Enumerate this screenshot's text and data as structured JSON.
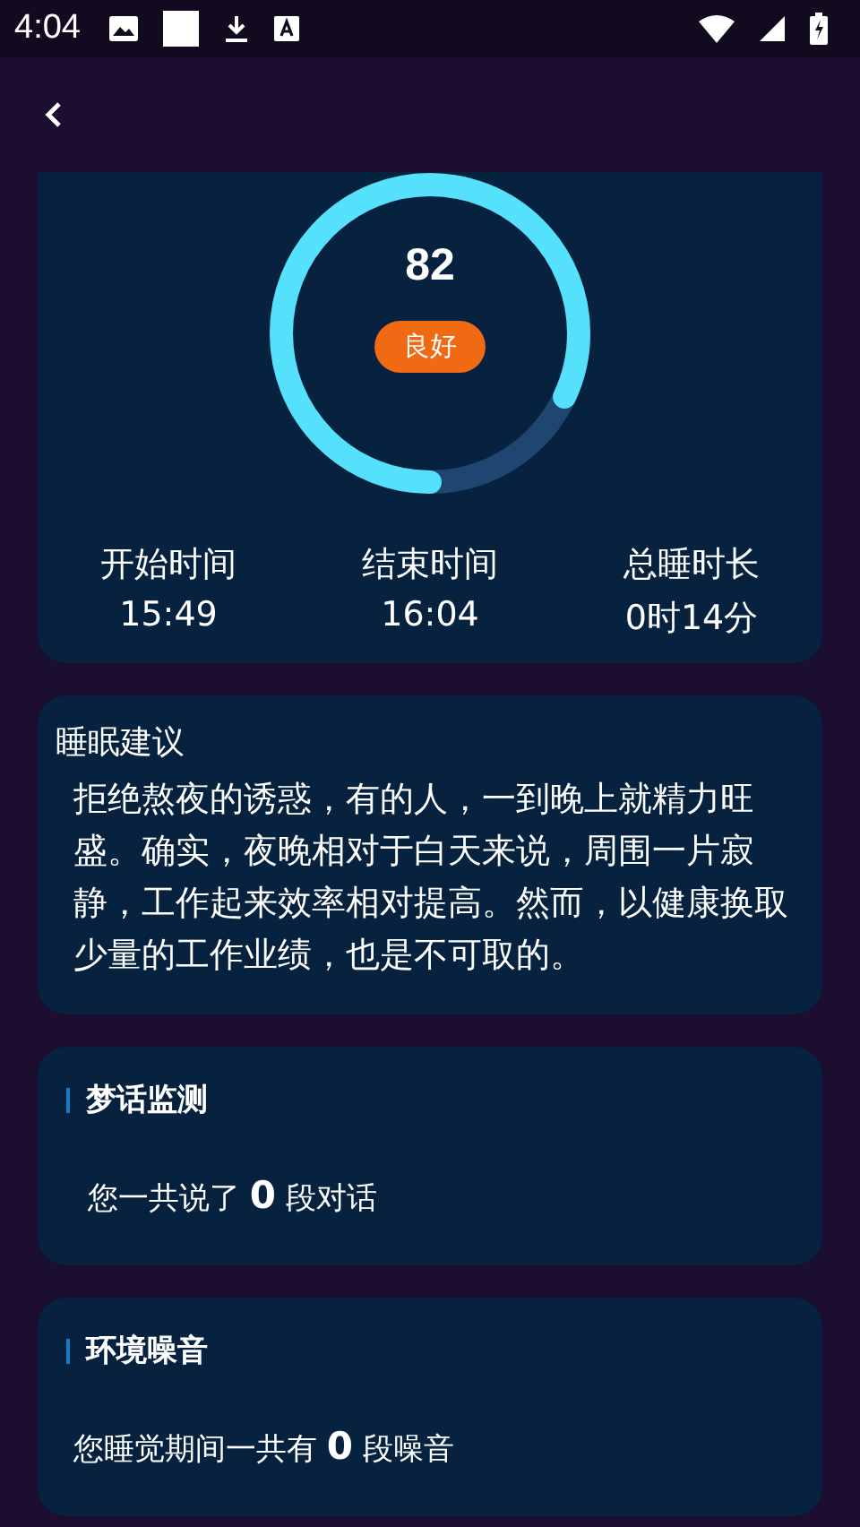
{
  "status_bar": {
    "time": "4:04"
  },
  "score": {
    "value": "82",
    "level": 0.82,
    "rating": "良好"
  },
  "stats": [
    {
      "label": "开始时间",
      "value": "15:49"
    },
    {
      "label": "结束时间",
      "value": "16:04"
    },
    {
      "label": "总睡时长",
      "value": "0时14分"
    }
  ],
  "advice": {
    "title": "睡眠建议",
    "text": "拒绝熬夜的诱惑，有的人，一到晚上就精力旺盛。确实，夜晚相对于白天来说，周围一片寂静，工作起来效率相对提高。然而，以健康换取少量的工作业绩，也是不可取的。"
  },
  "sections": [
    {
      "title": "梦话监测",
      "text": "您一共说了 **0** 段对话"
    },
    {
      "title": "环境噪音",
      "text": "您睡觉期间一共有 **0** 段噪音"
    }
  ]
}
